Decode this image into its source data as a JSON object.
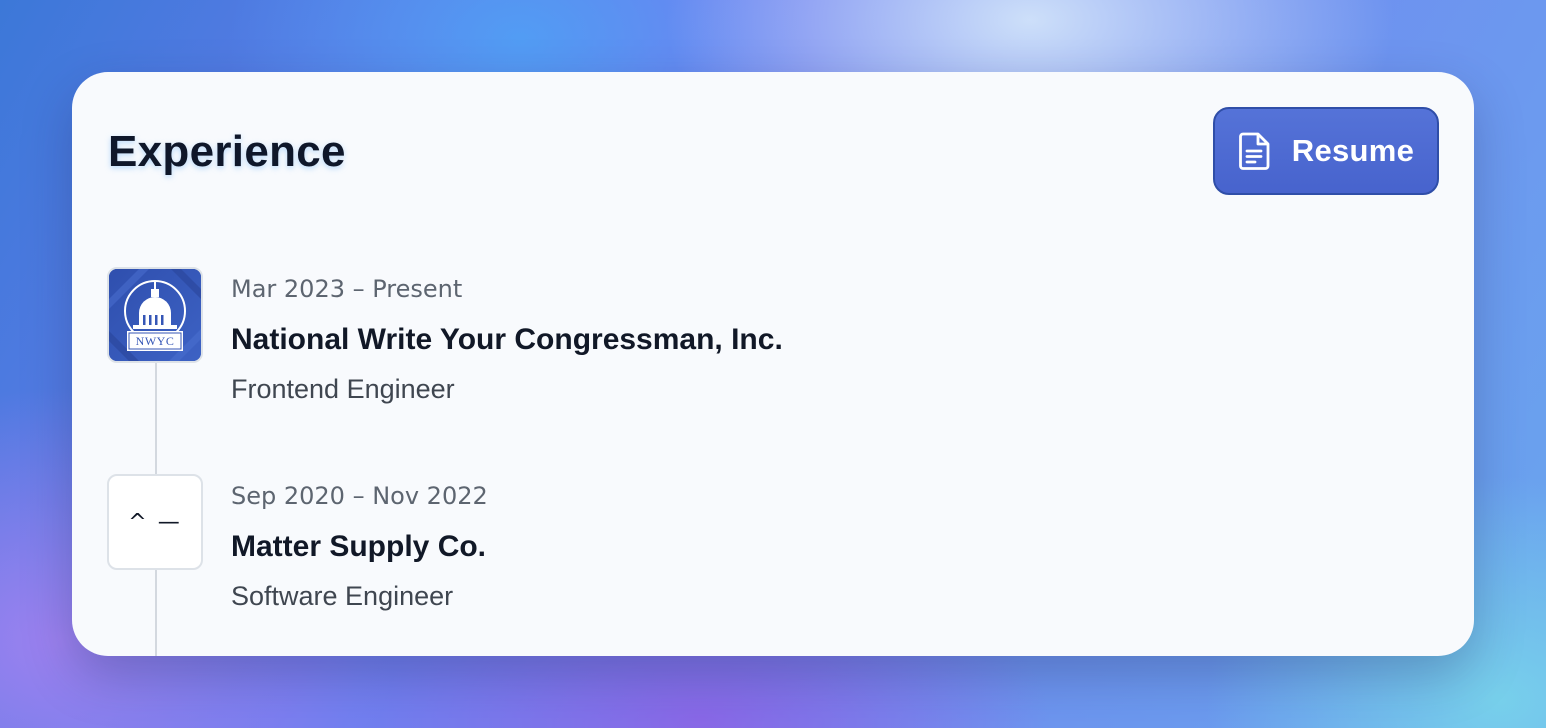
{
  "section": {
    "title": "Experience"
  },
  "resume_button": {
    "label": "Resume",
    "icon": "document-icon"
  },
  "experience": [
    {
      "dates": "Mar 2023 – Present",
      "company": "National Write Your Congressman, Inc.",
      "role": "Frontend Engineer",
      "logo_text": "NWYC"
    },
    {
      "dates": "Sep 2020 – Nov 2022",
      "company": "Matter Supply Co.",
      "role": "Software Engineer",
      "logo_text": "^ —"
    }
  ],
  "colors": {
    "accent": "#4b66d0",
    "card_background": "#f8fafd",
    "heading": "#0f172a"
  }
}
